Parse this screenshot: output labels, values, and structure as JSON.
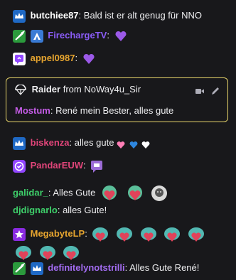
{
  "messages": [
    {
      "user": "butchiee87",
      "text": ": Bald ist er alt genug für NNO"
    },
    {
      "user": "FirechargeTV",
      "text": ":"
    },
    {
      "user": "appel0987",
      "text": ":"
    },
    {
      "user": "biskenza",
      "text": ": alles gute"
    },
    {
      "user": "PandarEUW",
      "text": ":"
    },
    {
      "user": "galidar_",
      "text": ": Alles Gute"
    },
    {
      "user": "djdignarlo",
      "text": ": alles Gute!"
    },
    {
      "user": "MegabyteLP",
      "text": ":"
    },
    {
      "user": "definitelynotstrilli",
      "text": ": Alles Gute René!"
    }
  ],
  "raid": {
    "label": "Raider",
    "from_text": "from NoWay4u_Sir",
    "message_user": "Mostum",
    "message_text": ": René mein Bester, alles gute"
  },
  "colors": {
    "background": "#18181b",
    "raid_border": "#e6d36a",
    "user_butchiee87": "#ffffff",
    "user_FirechargeTV": "#8a5cf6",
    "user_appel0987": "#e7a52f",
    "user_Mostum": "#c45ce6",
    "user_biskenza": "#e2457a",
    "user_PandarEUW": "#e2457a",
    "user_galidar": "#3ecf6a",
    "user_djdignarlo": "#3ecf6a",
    "user_MegabyteLP": "#e7a52f",
    "user_definitelynotstrilli": "#a36cf2"
  },
  "icons": [
    "subscriber-crown-badge",
    "sword-badge",
    "prime-badge",
    "verified-badge",
    "heart-icon",
    "chat-bubble-icon",
    "heart-cat-emote",
    "frog-hearts-emote",
    "face-emote",
    "star-badge",
    "parachute-icon",
    "video-icon",
    "pencil-icon"
  ]
}
